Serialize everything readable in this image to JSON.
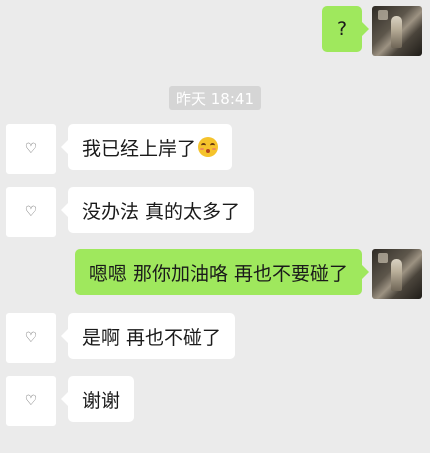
{
  "chat": {
    "timestamp": "昨天 18:41",
    "avatar_placeholder": "♡",
    "messages": [
      {
        "from": "self",
        "text": "?"
      },
      {
        "from": "other",
        "text": "我已经上岸了",
        "emoji": "flushed-face-emoji"
      },
      {
        "from": "other",
        "text": "没办法 真的太多了"
      },
      {
        "from": "self",
        "text": "嗯嗯 那你加油咯 再也不要碰了"
      },
      {
        "from": "other",
        "text": "是啊 再也不碰了"
      },
      {
        "from": "other",
        "text": "谢谢"
      }
    ]
  },
  "colors": {
    "background": "#ebebeb",
    "self_bubble": "#9fe85d",
    "other_bubble": "#ffffff",
    "timestamp_bg": "#d5d5d5"
  }
}
